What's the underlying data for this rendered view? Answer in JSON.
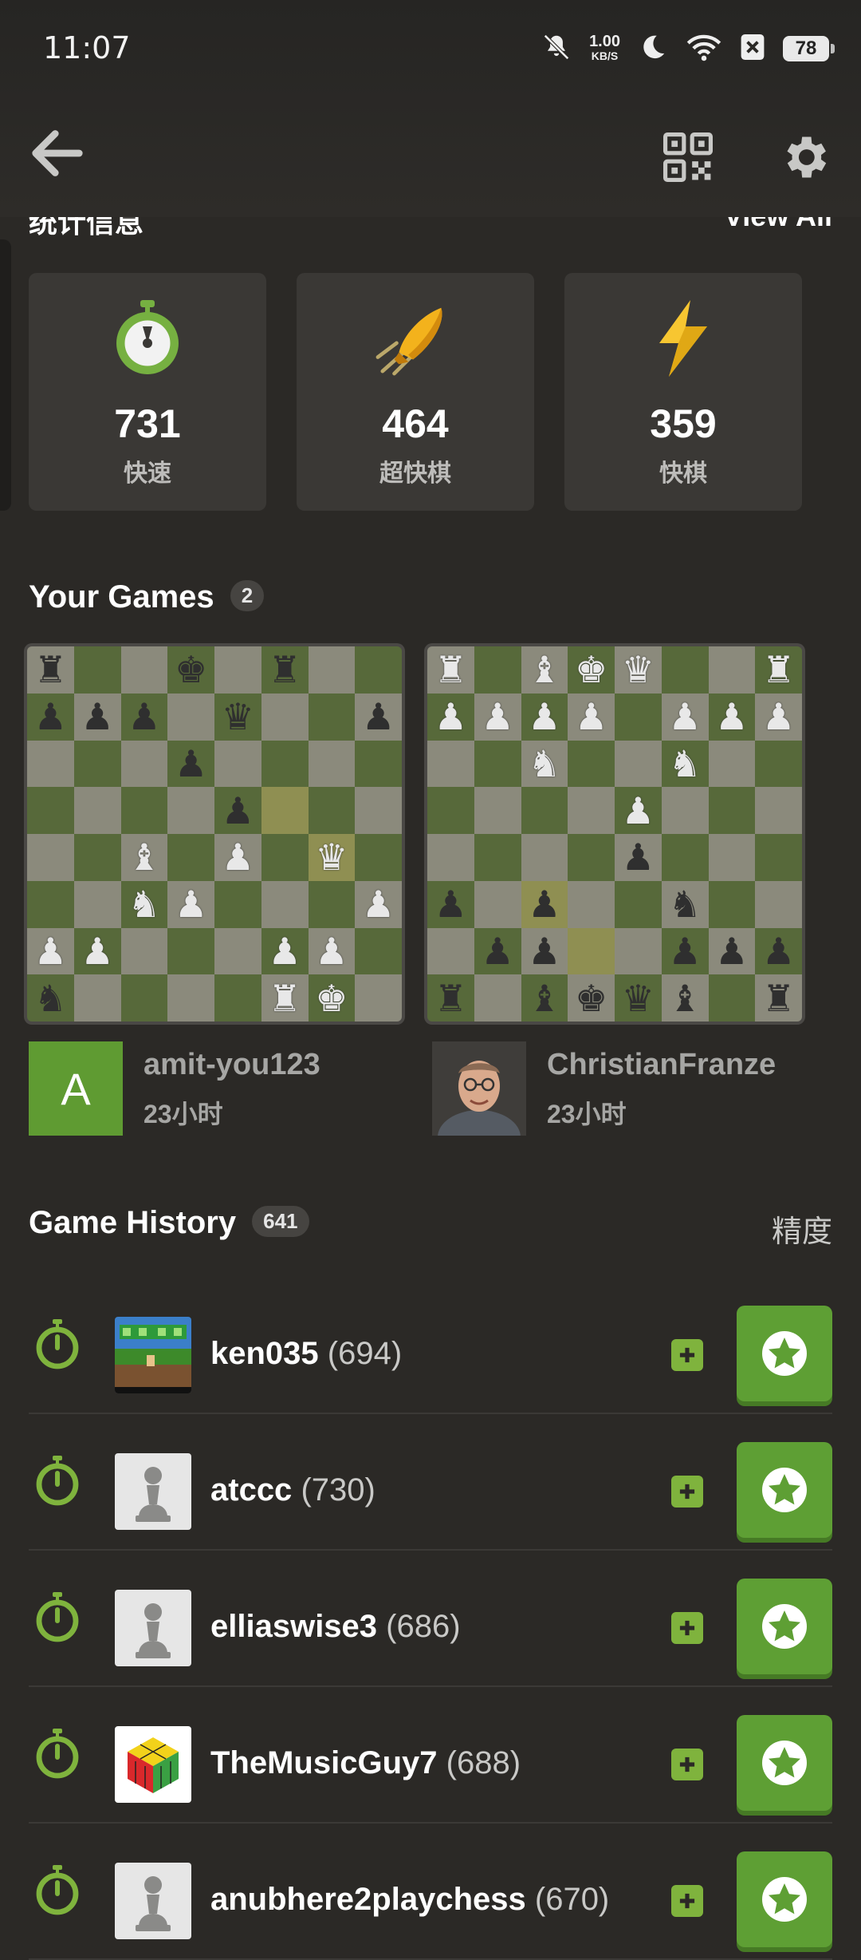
{
  "status_bar": {
    "time": "11:07",
    "net_speed": "1.00",
    "net_unit": "KB/S",
    "battery": "78"
  },
  "stats": {
    "heading": "统计信息",
    "view_all": "View All",
    "cards": [
      {
        "value": "731",
        "label": "快速",
        "icon": "rapid-stopwatch-icon"
      },
      {
        "value": "464",
        "label": "超快棋",
        "icon": "bullet-icon"
      },
      {
        "value": "359",
        "label": "快棋",
        "icon": "blitz-bolt-icon"
      }
    ]
  },
  "your_games": {
    "title": "Your Games",
    "count": "2",
    "games": [
      {
        "opponent": "amit-you123",
        "time": "23小时",
        "avatar_letter": "A"
      },
      {
        "opponent": "ChristianFranze",
        "time": "23小时"
      }
    ]
  },
  "game_history": {
    "title": "Game History",
    "count": "641",
    "accuracy_label": "精度",
    "rows": [
      {
        "name": "ken035",
        "rating": "(694)",
        "avatar": "pixel-art"
      },
      {
        "name": "atccc",
        "rating": "(730)",
        "avatar": "pawn"
      },
      {
        "name": "elliaswise3",
        "rating": "(686)",
        "avatar": "pawn"
      },
      {
        "name": "TheMusicGuy7",
        "rating": "(688)",
        "avatar": "cube"
      },
      {
        "name": "anubhere2playchess",
        "rating": "(670)",
        "avatar": "pawn"
      }
    ]
  },
  "colors": {
    "background": "#2b2926",
    "card": "#3a3835",
    "accent_green": "#5e9f34",
    "board_light": "#8b8a7c",
    "board_dark": "#57693a"
  }
}
